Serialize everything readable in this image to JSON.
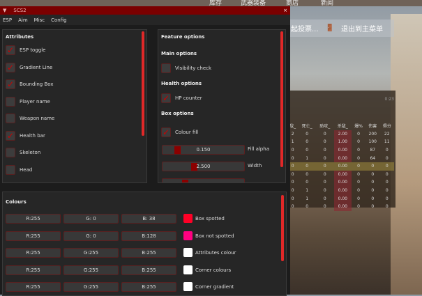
{
  "background": {
    "nav": [
      "库存",
      "武器装备",
      "商店",
      "新闻"
    ],
    "vote_label": "起投票...",
    "exit_label": "退出到主菜单"
  },
  "scoreboard": {
    "time": "0:23",
    "headers": [
      "敌_",
      "死亡_",
      "助攻_",
      "杀敌_",
      "爆%",
      "伤害",
      "得分"
    ],
    "rows": [
      [
        "2",
        "0",
        "0",
        "2.00",
        "0",
        "200",
        "22"
      ],
      [
        "1",
        "0",
        "0",
        "1.00",
        "0",
        "100",
        "11"
      ],
      [
        "0",
        "0",
        "0",
        "0.00",
        "0",
        "87",
        "0"
      ],
      [
        "0",
        "1",
        "0",
        "0.00",
        "0",
        "64",
        "0"
      ],
      [
        "0",
        "0",
        "0",
        "0.00",
        "0",
        "0",
        "0"
      ],
      [
        "0",
        "0",
        "0",
        "0.00",
        "0",
        "0",
        "0"
      ],
      [
        "0",
        "0",
        "0",
        "0.00",
        "0",
        "0",
        "0"
      ],
      [
        "0",
        "1",
        "0",
        "0.00",
        "0",
        "0",
        "0"
      ],
      [
        "0",
        "1",
        "0",
        "0.00",
        "0",
        "0",
        "0"
      ],
      [
        "0",
        "0",
        "0",
        "0.00",
        "0",
        "0",
        "0"
      ]
    ]
  },
  "window": {
    "title": "SCS2",
    "close": "×",
    "collapse": "▼",
    "tabs": [
      "ESP",
      "Aim",
      "Misc",
      "Config"
    ]
  },
  "attributes": {
    "title": "Attributes",
    "items": [
      {
        "label": "ESP toggle",
        "checked": true
      },
      {
        "label": "Gradient Line",
        "checked": true
      },
      {
        "label": "Bounding Box",
        "checked": true
      },
      {
        "label": "Player name",
        "checked": false
      },
      {
        "label": "Weapon name",
        "checked": false
      },
      {
        "label": "Health bar",
        "checked": true
      },
      {
        "label": "Skeleton",
        "checked": false
      },
      {
        "label": "Head",
        "checked": false
      }
    ]
  },
  "features": {
    "title": "Feature options",
    "main_title": "Main options",
    "visibility": "Visibility check",
    "health_title": "Health options",
    "hp": "HP counter",
    "box_title": "Box options",
    "colour_fill": "Colour fill",
    "fill_alpha_value": "0.150",
    "fill_alpha_label": "Fill alpha",
    "width_value": "2.500",
    "width_label": "Width"
  },
  "colours": {
    "title": "Colours",
    "rows": [
      {
        "r": "R:255",
        "g": "G:  0",
        "b": "B: 38",
        "color": "#ff0026",
        "label": "Box spotted"
      },
      {
        "r": "R:255",
        "g": "G:  0",
        "b": "B:128",
        "color": "#ff0080",
        "label": "Box not spotted"
      },
      {
        "r": "R:255",
        "g": "G:255",
        "b": "B:255",
        "color": "#ffffff",
        "label": "Attributes colour"
      },
      {
        "r": "R:255",
        "g": "G:255",
        "b": "B:255",
        "color": "#ffffff",
        "label": "Corner colours"
      },
      {
        "r": "R:255",
        "g": "G:255",
        "b": "B:255",
        "color": "#ffffff",
        "label": "Corner gradient"
      }
    ]
  }
}
